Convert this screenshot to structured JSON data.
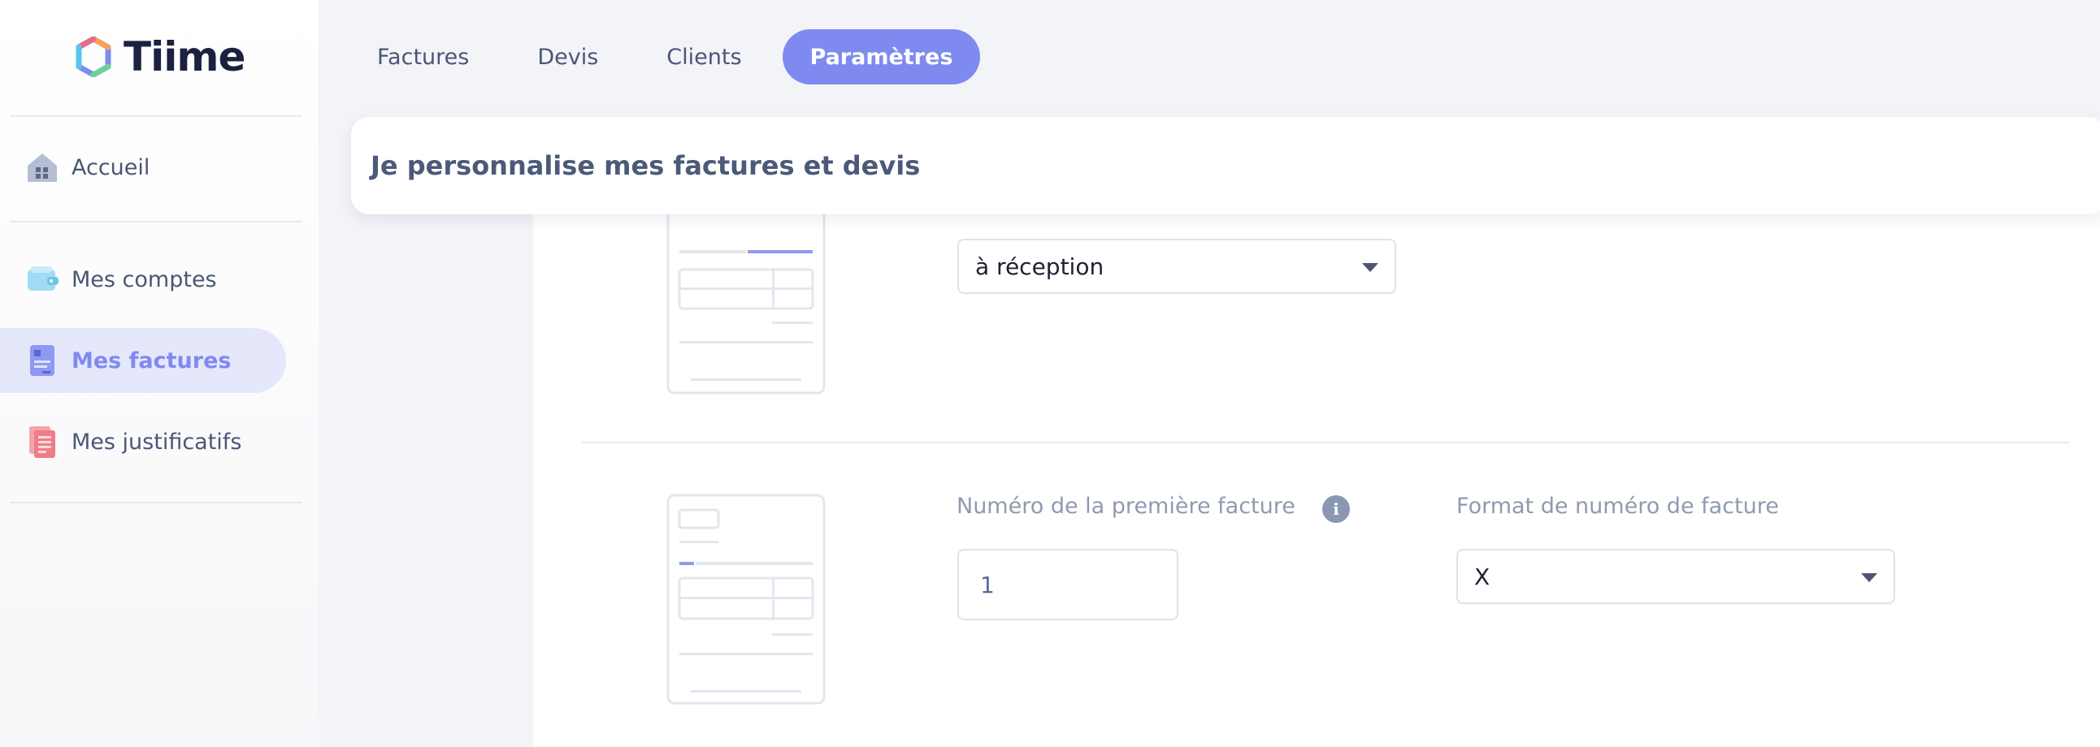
{
  "app": {
    "logo_text": "Tiime",
    "logo_colors": [
      "#f5a25d",
      "#e86a8a",
      "#7d8cf0",
      "#58c6e8",
      "#6fd19a"
    ]
  },
  "sidebar": {
    "items": [
      {
        "label": "Accueil",
        "icon": "home-icon"
      },
      {
        "label": "Mes comptes",
        "icon": "wallet-icon"
      },
      {
        "label": "Mes factures",
        "icon": "invoice-icon",
        "active": true
      },
      {
        "label": "Mes justificatifs",
        "icon": "receipt-icon"
      }
    ]
  },
  "tabs": [
    {
      "label": "Factures"
    },
    {
      "label": "Devis"
    },
    {
      "label": "Clients"
    },
    {
      "label": "Paramètres",
      "active": true
    }
  ],
  "page": {
    "title": "Je personnalise mes factures et devis"
  },
  "section_payment": {
    "select_value": "à réception"
  },
  "section_numbering": {
    "first_number_label": "Numéro de la première facture",
    "first_number_value": "1",
    "format_label": "Format de numéro de facture",
    "format_value": "X",
    "info_glyph": "i"
  },
  "colors": {
    "accent": "#7f8af0",
    "active_nav_bg": "#e5e7fb",
    "text": "#4b5675",
    "muted_label": "#8f9ab0"
  }
}
